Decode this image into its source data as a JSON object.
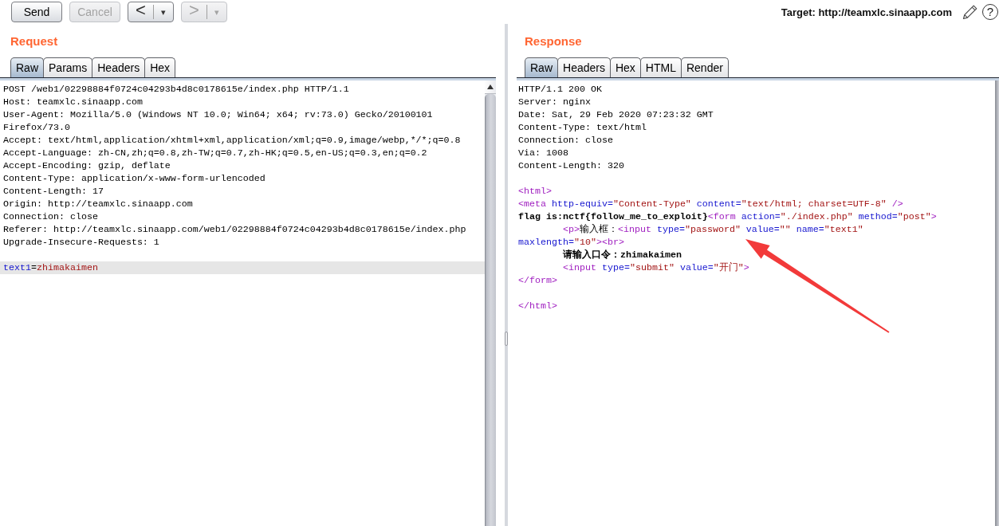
{
  "toolbar": {
    "buttons": [
      {
        "kind": "text",
        "label": "Send",
        "disabled": false
      },
      {
        "kind": "text",
        "label": "Cancel",
        "disabled": true
      },
      {
        "kind": "history",
        "label": "<",
        "menu": "▾",
        "disabled": false
      },
      {
        "kind": "history",
        "label": ">",
        "menu": "▾",
        "disabled": true
      }
    ],
    "target": "Target: http://teamxlc.sinaapp.com",
    "help": "?"
  },
  "request": {
    "title": "Request",
    "tabs": [
      {
        "label": "Raw",
        "selected": true
      },
      {
        "label": "Params",
        "selected": false
      },
      {
        "label": "Headers",
        "selected": false
      },
      {
        "label": "Hex",
        "selected": false
      }
    ],
    "lines": [
      {
        "kind": "plain",
        "highlighted": false,
        "text": "POST /web1/02298884f0724c04293b4d8c0178615e/index.php HTTP/1.1"
      },
      {
        "kind": "plain",
        "highlighted": false,
        "text": "Host: teamxlc.sinaapp.com"
      },
      {
        "kind": "plain",
        "highlighted": false,
        "text": "User-Agent: Mozilla/5.0 (Windows NT 10.0; Win64; x64; rv:73.0) Gecko/20100101"
      },
      {
        "kind": "plain",
        "highlighted": false,
        "text": "Firefox/73.0"
      },
      {
        "kind": "plain",
        "highlighted": false,
        "text": "Accept: text/html,application/xhtml+xml,application/xml;q=0.9,image/webp,*/*;q=0.8"
      },
      {
        "kind": "plain",
        "highlighted": false,
        "text": "Accept-Language: zh-CN,zh;q=0.8,zh-TW;q=0.7,zh-HK;q=0.5,en-US;q=0.3,en;q=0.2"
      },
      {
        "kind": "plain",
        "highlighted": false,
        "text": "Accept-Encoding: gzip, deflate"
      },
      {
        "kind": "plain",
        "highlighted": false,
        "text": "Content-Type: application/x-www-form-urlencoded"
      },
      {
        "kind": "plain",
        "highlighted": false,
        "text": "Content-Length: 17"
      },
      {
        "kind": "plain",
        "highlighted": false,
        "text": "Origin: http://teamxlc.sinaapp.com"
      },
      {
        "kind": "plain",
        "highlighted": false,
        "text": "Connection: close"
      },
      {
        "kind": "plain",
        "highlighted": false,
        "text": "Referer: http://teamxlc.sinaapp.com/web1/02298884f0724c04293b4d8c0178615e/index.php"
      },
      {
        "kind": "plain",
        "highlighted": false,
        "text": "Upgrade-Insecure-Requests: 1"
      },
      {
        "kind": "blank",
        "highlighted": false
      },
      {
        "kind": "markup",
        "highlighted": true,
        "segments": [
          {
            "kind": "attr",
            "text": "text1"
          },
          {
            "kind": "plain",
            "text": "="
          },
          {
            "kind": "value",
            "text": "zhimakaimen"
          }
        ]
      }
    ]
  },
  "response": {
    "title": "Response",
    "tabs": [
      {
        "label": "Raw",
        "selected": true
      },
      {
        "label": "Headers",
        "selected": false
      },
      {
        "label": "Hex",
        "selected": false
      },
      {
        "label": "HTML",
        "selected": false
      },
      {
        "label": "Render",
        "selected": false
      }
    ],
    "lines": [
      {
        "kind": "plain",
        "text": "HTTP/1.1 200 OK"
      },
      {
        "kind": "plain",
        "text": "Server: nginx"
      },
      {
        "kind": "plain",
        "text": "Date: Sat, 29 Feb 2020 07:23:32 GMT"
      },
      {
        "kind": "plain",
        "text": "Content-Type: text/html"
      },
      {
        "kind": "plain",
        "text": "Connection: close"
      },
      {
        "kind": "plain",
        "text": "Via: 1008"
      },
      {
        "kind": "plain",
        "text": "Content-Length: 320"
      },
      {
        "kind": "blank"
      },
      {
        "kind": "markup",
        "segments": [
          {
            "kind": "tag",
            "text": "<html>"
          }
        ]
      },
      {
        "kind": "markup",
        "segments": [
          {
            "kind": "tag",
            "text": "<meta"
          },
          {
            "kind": "attr",
            "text": " http-equiv="
          },
          {
            "kind": "value",
            "text": "\"Content-Type\""
          },
          {
            "kind": "attr",
            "text": " content="
          },
          {
            "kind": "value",
            "text": "\"text/html; charset=UTF-8\""
          },
          {
            "kind": "tag",
            "text": " />"
          }
        ]
      },
      {
        "kind": "markup",
        "segments": [
          {
            "kind": "bold",
            "text": "flag is:nctf{follow_me_to_exploit}"
          },
          {
            "kind": "tag",
            "text": "<form"
          },
          {
            "kind": "attr",
            "text": " action="
          },
          {
            "kind": "value",
            "text": "\"./index.php\""
          },
          {
            "kind": "attr",
            "text": " method="
          },
          {
            "kind": "value",
            "text": "\"post\""
          },
          {
            "kind": "tag",
            "text": ">"
          }
        ]
      },
      {
        "kind": "markup",
        "segments": [
          {
            "kind": "tag",
            "text": "        <p>"
          },
          {
            "kind": "plain",
            "text": "输入框："
          },
          {
            "kind": "tag",
            "text": "<input"
          },
          {
            "kind": "attr",
            "text": " type="
          },
          {
            "kind": "value",
            "text": "\"password\""
          },
          {
            "kind": "attr",
            "text": " value="
          },
          {
            "kind": "value",
            "text": "\"\""
          },
          {
            "kind": "attr",
            "text": " name="
          },
          {
            "kind": "value",
            "text": "\"text1\""
          }
        ]
      },
      {
        "kind": "markup",
        "segments": [
          {
            "kind": "attr",
            "text": "maxlength="
          },
          {
            "kind": "value",
            "text": "\"10\""
          },
          {
            "kind": "tag",
            "text": "><br>"
          }
        ]
      },
      {
        "kind": "markup",
        "segments": [
          {
            "kind": "bold",
            "text": "        请输入口令：zhimakaimen"
          }
        ]
      },
      {
        "kind": "markup",
        "segments": [
          {
            "kind": "tag",
            "text": "        <input"
          },
          {
            "kind": "attr",
            "text": " type="
          },
          {
            "kind": "value",
            "text": "\"submit\""
          },
          {
            "kind": "attr",
            "text": " value="
          },
          {
            "kind": "value",
            "text": "\"开门\""
          },
          {
            "kind": "tag",
            "text": ">"
          }
        ]
      },
      {
        "kind": "markup",
        "segments": [
          {
            "kind": "tag",
            "text": "</form>"
          }
        ]
      },
      {
        "kind": "blank"
      },
      {
        "kind": "markup",
        "segments": [
          {
            "kind": "tag",
            "text": "</html>"
          }
        ]
      }
    ]
  },
  "annotations": [
    {
      "kind": "arrow"
    }
  ]
}
